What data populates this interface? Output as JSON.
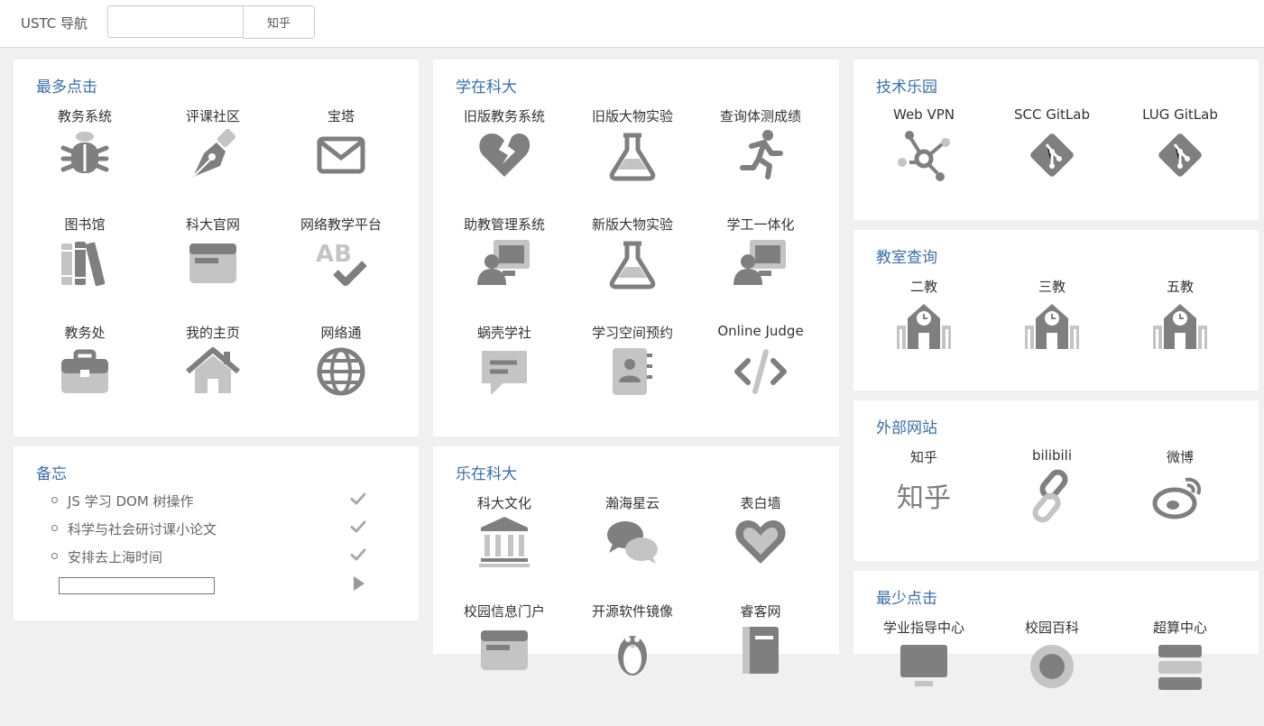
{
  "nav": {
    "brand": "USTC 导航",
    "search_value": "",
    "search_placeholder": "",
    "search_button": "知乎"
  },
  "sections": {
    "most_clicked": {
      "title": "最多点击",
      "items": [
        {
          "label": "教务系统",
          "icon": "bug-icon"
        },
        {
          "label": "评课社区",
          "icon": "pen-nib-icon"
        },
        {
          "label": "宝塔",
          "icon": "envelope-icon"
        },
        {
          "label": "图书馆",
          "icon": "books-icon"
        },
        {
          "label": "科大官网",
          "icon": "browser-window-icon"
        },
        {
          "label": "网络教学平台",
          "icon": "spellcheck-icon"
        },
        {
          "label": "教务处",
          "icon": "briefcase-icon"
        },
        {
          "label": "我的主页",
          "icon": "home-icon"
        },
        {
          "label": "网络通",
          "icon": "globe-icon"
        }
      ]
    },
    "study": {
      "title": "学在科大",
      "items": [
        {
          "label": "旧版教务系统",
          "icon": "broken-heart-icon"
        },
        {
          "label": "旧版大物实验",
          "icon": "flask-icon"
        },
        {
          "label": "查询体测成绩",
          "icon": "running-icon"
        },
        {
          "label": "助教管理系统",
          "icon": "teacher-board-icon"
        },
        {
          "label": "新版大物实验",
          "icon": "flask-icon"
        },
        {
          "label": "学工一体化",
          "icon": "teacher-board-icon"
        },
        {
          "label": "蜗壳学社",
          "icon": "comment-alt-icon"
        },
        {
          "label": "学习空间预约",
          "icon": "address-book-icon"
        },
        {
          "label": "Online Judge",
          "icon": "code-icon"
        }
      ]
    },
    "tech": {
      "title": "技术乐园",
      "items": [
        {
          "label": "Web VPN",
          "icon": "network-icon"
        },
        {
          "label": "SCC GitLab",
          "icon": "git-icon"
        },
        {
          "label": "LUG GitLab",
          "icon": "git-icon"
        }
      ]
    },
    "classroom": {
      "title": "教室查询",
      "items": [
        {
          "label": "二教",
          "icon": "school-icon"
        },
        {
          "label": "三教",
          "icon": "school-icon"
        },
        {
          "label": "五教",
          "icon": "school-icon"
        }
      ]
    },
    "external": {
      "title": "外部网站",
      "items": [
        {
          "label": "知乎",
          "icon": "zhihu-icon",
          "icon_text": "知乎"
        },
        {
          "label": "bilibili",
          "icon": "link-icon"
        },
        {
          "label": "微博",
          "icon": "weibo-icon"
        }
      ]
    },
    "memo": {
      "title": "备忘",
      "entries": [
        "JS 学习 DOM 树操作",
        "科学与社会研讨课小论文",
        "安排去上海时间"
      ],
      "input_value": ""
    },
    "fun": {
      "title": "乐在科大",
      "items": [
        {
          "label": "科大文化",
          "icon": "landmark-icon"
        },
        {
          "label": "瀚海星云",
          "icon": "comments-icon"
        },
        {
          "label": "表白墙",
          "icon": "heart-icon"
        },
        {
          "label": "校园信息门户",
          "icon": "browser-window-icon"
        },
        {
          "label": "开源软件镜像",
          "icon": "linux-icon"
        },
        {
          "label": "睿客网",
          "icon": "book-icon"
        }
      ]
    },
    "least_clicked": {
      "title": "最少点击",
      "items": [
        {
          "label": "学业指导中心",
          "icon": "tv-icon"
        },
        {
          "label": "校园百科",
          "icon": "circle-icon"
        },
        {
          "label": "超算中心",
          "icon": "server-icon"
        }
      ]
    }
  },
  "colors": {
    "accent_title": "#3a6fa6",
    "icon_dark": "#7f7f7f",
    "icon_light": "#c4c4c4",
    "page_background": "#f0f0f0"
  }
}
